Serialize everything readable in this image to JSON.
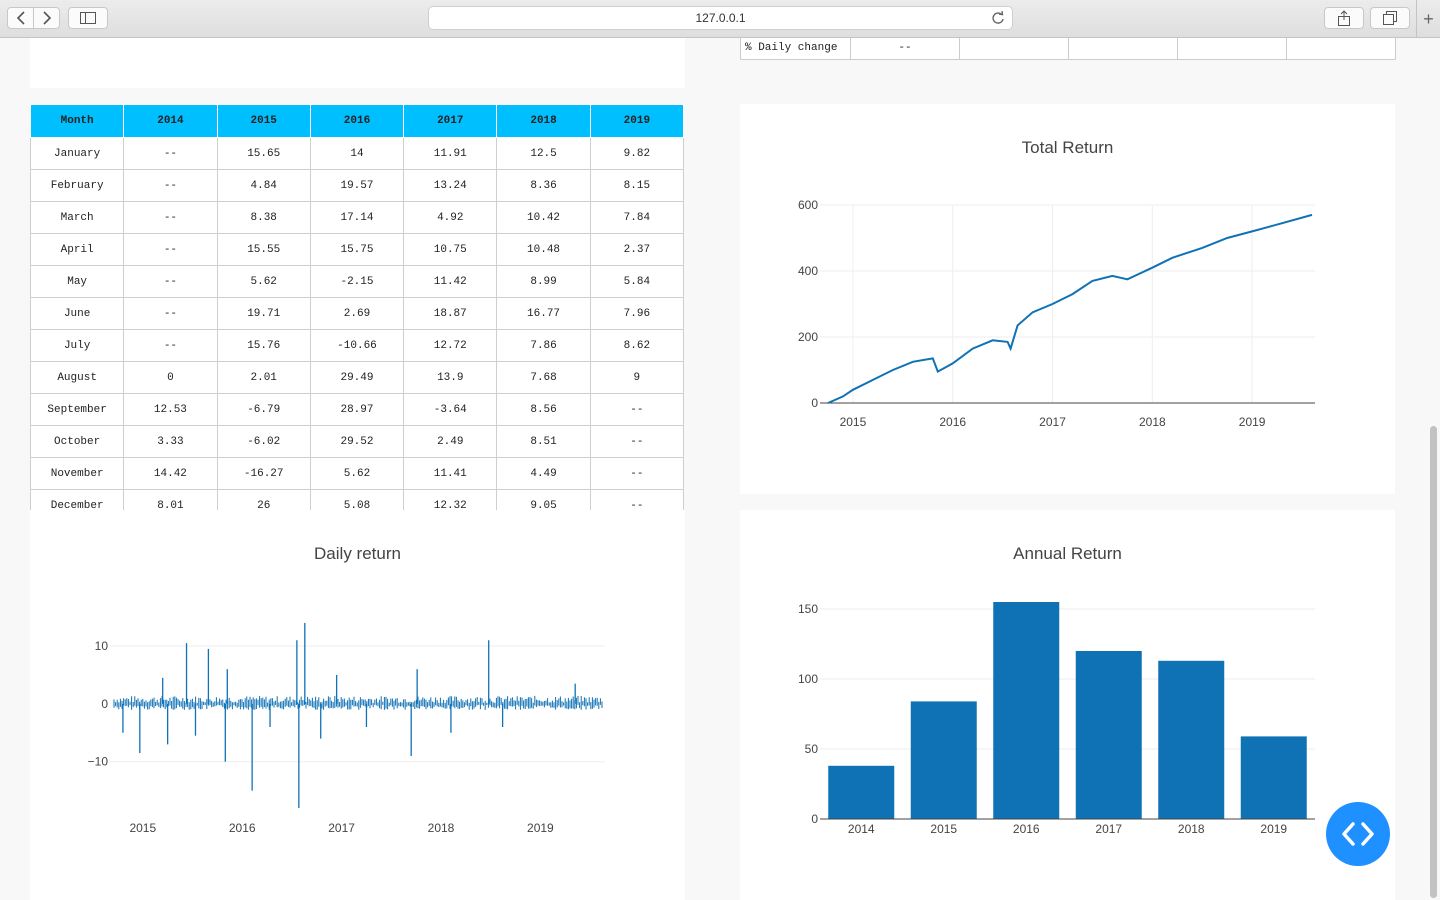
{
  "browser": {
    "url": "127.0.0.1"
  },
  "stats": {
    "label": "% Daily change",
    "value": "--"
  },
  "monthly": {
    "headers": [
      "Month",
      "2014",
      "2015",
      "2016",
      "2017",
      "2018",
      "2019"
    ],
    "rows": [
      [
        "January",
        "--",
        "15.65",
        "14",
        "11.91",
        "12.5",
        "9.82"
      ],
      [
        "February",
        "--",
        "4.84",
        "19.57",
        "13.24",
        "8.36",
        "8.15"
      ],
      [
        "March",
        "--",
        "8.38",
        "17.14",
        "4.92",
        "10.42",
        "7.84"
      ],
      [
        "April",
        "--",
        "15.55",
        "15.75",
        "10.75",
        "10.48",
        "2.37"
      ],
      [
        "May",
        "--",
        "5.62",
        "-2.15",
        "11.42",
        "8.99",
        "5.84"
      ],
      [
        "June",
        "--",
        "19.71",
        "2.69",
        "18.87",
        "16.77",
        "7.96"
      ],
      [
        "July",
        "--",
        "15.76",
        "-10.66",
        "12.72",
        "7.86",
        "8.62"
      ],
      [
        "August",
        "0",
        "2.01",
        "29.49",
        "13.9",
        "7.68",
        "9"
      ],
      [
        "September",
        "12.53",
        "-6.79",
        "28.97",
        "-3.64",
        "8.56",
        "--"
      ],
      [
        "October",
        "3.33",
        "-6.02",
        "29.52",
        "2.49",
        "8.51",
        "--"
      ],
      [
        "November",
        "14.42",
        "-16.27",
        "5.62",
        "11.41",
        "4.49",
        "--"
      ],
      [
        "December",
        "8.01",
        "26",
        "5.08",
        "12.32",
        "9.05",
        "--"
      ]
    ]
  },
  "colors": {
    "series": "#0f72b5",
    "header": "#00bfff",
    "fab": "#1e90ff"
  },
  "icons": {
    "fab": "code-brackets-icon"
  },
  "chart_data": [
    {
      "id": "total",
      "type": "line",
      "title": "Total Return",
      "x": [
        2014.75,
        2014.9,
        2015.0,
        2015.2,
        2015.4,
        2015.6,
        2015.8,
        2015.85,
        2016.0,
        2016.2,
        2016.4,
        2016.55,
        2016.58,
        2016.65,
        2016.8,
        2017.0,
        2017.2,
        2017.4,
        2017.6,
        2017.75,
        2018.0,
        2018.2,
        2018.5,
        2018.75,
        2019.0,
        2019.3,
        2019.6
      ],
      "y": [
        0,
        20,
        40,
        70,
        100,
        125,
        135,
        95,
        120,
        165,
        190,
        185,
        165,
        235,
        275,
        300,
        330,
        370,
        385,
        375,
        410,
        440,
        470,
        500,
        520,
        545,
        570
      ],
      "xticks": [
        "2015",
        "2016",
        "2017",
        "2018",
        "2019"
      ],
      "xtick_values": [
        2015,
        2016,
        2017,
        2018,
        2019
      ],
      "yticks": [
        0,
        200,
        400,
        600
      ],
      "xlim": [
        2014.67,
        2019.63
      ],
      "ylim": [
        0,
        600
      ]
    },
    {
      "id": "daily",
      "type": "bar",
      "title": "Daily return",
      "xticks": [
        "2015",
        "2016",
        "2017",
        "2018",
        "2019"
      ],
      "xtick_values": [
        2015,
        2016,
        2017,
        2018,
        2019
      ],
      "ytick_labels": [
        "10",
        "0",
        "−10"
      ],
      "ytick_values": [
        10,
        0,
        -10
      ],
      "xlim": [
        2014.67,
        2019.65
      ],
      "ylim": [
        -18,
        14.5
      ],
      "x": [
        2014.8,
        2014.97,
        2015.2,
        2015.25,
        2015.44,
        2015.53,
        2015.66,
        2015.83,
        2015.85,
        2016.1,
        2016.28,
        2016.55,
        2016.57,
        2016.63,
        2016.79,
        2016.95,
        2017.25,
        2017.7,
        2017.76,
        2018.1,
        2018.48,
        2018.62,
        2019.35
      ],
      "values": [
        -5,
        -8.5,
        4.5,
        -7,
        10.5,
        -5.5,
        9.5,
        -10,
        6,
        -15,
        -4,
        11,
        -18,
        14,
        -6,
        5,
        -4,
        -9,
        6,
        -5,
        11,
        -4,
        3.5
      ]
    },
    {
      "id": "annual",
      "type": "bar",
      "title": "Annual Return",
      "categories": [
        "2014",
        "2015",
        "2016",
        "2017",
        "2018",
        "2019"
      ],
      "values": [
        38,
        84,
        155,
        120,
        113,
        59
      ],
      "yticks": [
        0,
        50,
        100,
        150
      ],
      "ylim": [
        0,
        165
      ]
    }
  ]
}
